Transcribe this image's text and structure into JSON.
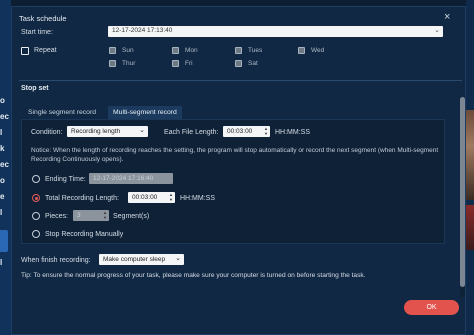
{
  "background": {
    "left_fragments": [
      "o",
      "ec",
      "l",
      "k",
      "ec",
      "o",
      "e",
      "l",
      "l"
    ]
  },
  "dialog": {
    "title": "Task schedule",
    "close_icon": "×",
    "start_time_label": "Start time:",
    "start_time_value": "12-17-2024 17:13:40",
    "repeat_label": "Repeat",
    "days": [
      {
        "label": "Sun"
      },
      {
        "label": "Mon"
      },
      {
        "label": "Tues"
      },
      {
        "label": "Wed"
      },
      {
        "label": "Thur"
      },
      {
        "label": "Fri"
      },
      {
        "label": "Sat"
      }
    ],
    "stop_set_label": "Stop set",
    "tabs": [
      {
        "label": "Single segment record",
        "active": false
      },
      {
        "label": "Multi-segment record",
        "active": true
      }
    ],
    "condition_label": "Condition:",
    "condition_value": "Recording length",
    "file_length_label": "Each File Length:",
    "file_length_value": "00:03:00",
    "file_length_format": "HH:MM:SS",
    "notice": "Notice: When the length of recording reaches the setting, the program will stop automatically or record the next segment (when Multi-segment Recording Continuously opens).",
    "ending_time_label": "Ending Time:",
    "ending_time_value": "12-17-2024 17:16:40",
    "total_length_label": "Total Recording Length:",
    "total_length_value": "00:03:00",
    "total_length_format": "HH:MM:SS",
    "pieces_label": "Pieces:",
    "pieces_value": "3",
    "pieces_unit": "Segment(s)",
    "stop_manually_label": "Stop Recording Manually",
    "when_finish_label": "When finish recording:",
    "when_finish_value": "Make computer sleep",
    "tip": "Tip: To ensure the normal progress of your task, please make sure your computer is turned on before starting the task.",
    "ok_label": "OK"
  },
  "colors": {
    "accent": "#e2534d",
    "dialog_bg": "#102844",
    "panel_bg": "#0e2137"
  }
}
